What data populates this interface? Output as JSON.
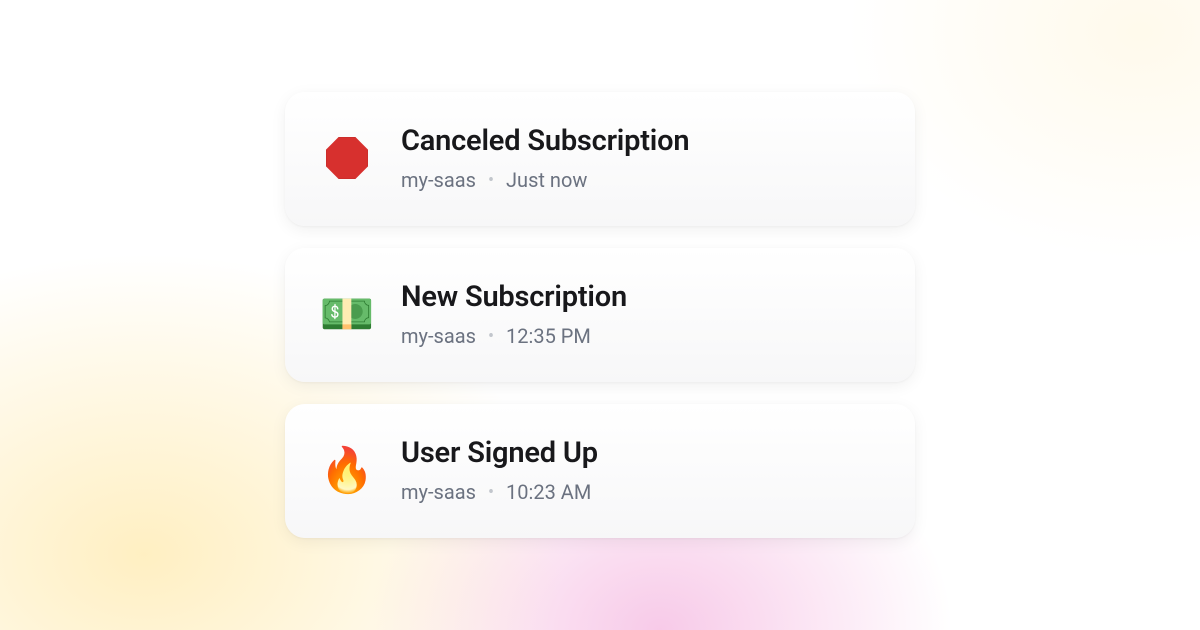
{
  "notifications": [
    {
      "icon": "stop-sign",
      "title": "Canceled Subscription",
      "project": "my-saas",
      "time": "Just now"
    },
    {
      "icon": "money",
      "title": "New Subscription",
      "project": "my-saas",
      "time": "12:35 PM"
    },
    {
      "icon": "fire",
      "title": "User Signed Up",
      "project": "my-saas",
      "time": "10:23 AM"
    }
  ],
  "icon_glyphs": {
    "money": "💵",
    "fire": "🔥"
  }
}
